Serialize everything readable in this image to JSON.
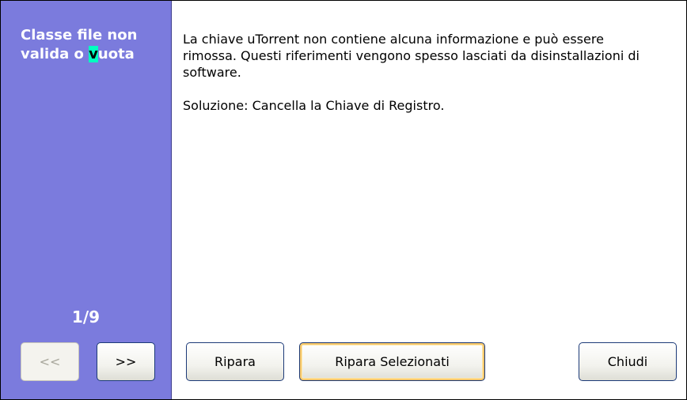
{
  "sidebar": {
    "title_before": "Classe file non valida o ",
    "title_highlight": "v",
    "title_after": "uota",
    "counter": "1/9"
  },
  "nav": {
    "prev_label": "<<",
    "next_label": ">>"
  },
  "content": {
    "description": "La chiave uTorrent non contiene alcuna informazione e può essere rimossa. Questi riferimenti vengono spesso lasciati da disinstallazioni di software.",
    "solution": "Soluzione: Cancella la Chiave di Registro."
  },
  "buttons": {
    "repair": "Ripara",
    "repair_selected": "Ripara Selezionati",
    "close": "Chiudi"
  }
}
